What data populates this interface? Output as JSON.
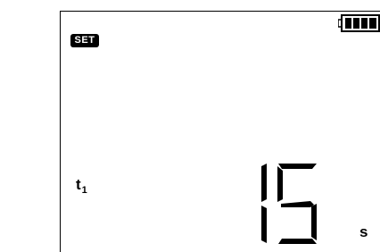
{
  "status": {
    "set_label": "SET",
    "battery_icon": "battery-full-icon",
    "battery_level": 1.0
  },
  "parameter": {
    "symbol": "t",
    "subscript": "1"
  },
  "reading": {
    "value": "15",
    "unit": "s"
  }
}
